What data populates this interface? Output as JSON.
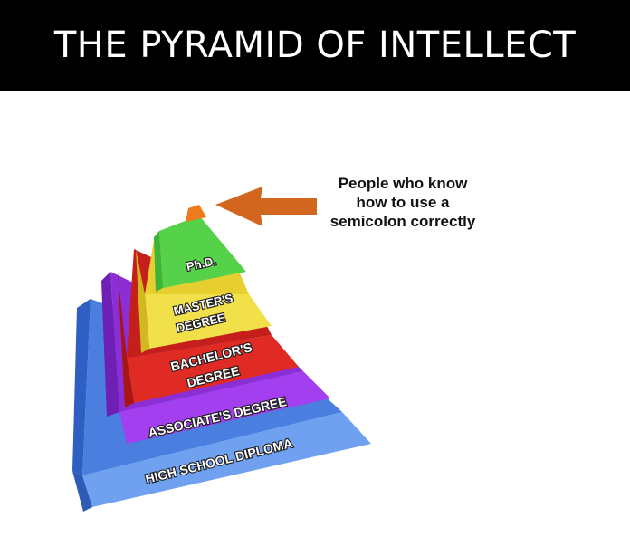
{
  "title": "THE PYRAMID OF INTELLECT",
  "callout": {
    "lines": [
      "People who know",
      "how to use a",
      "semicolon correctly"
    ]
  },
  "pyramid": {
    "layers": [
      {
        "label_lines": [
          "HIGH SCHOOL DIPLOMA"
        ],
        "color": "#4a7fe0"
      },
      {
        "label_lines": [
          "ASSOCIATE'S DEGREE"
        ],
        "color": "#9b2fe6"
      },
      {
        "label_lines": [
          "BACHELOR'S",
          "DEGREE"
        ],
        "color": "#e02b25"
      },
      {
        "label_lines": [
          "MASTER'S",
          "DEGREE"
        ],
        "color": "#f2e04a"
      },
      {
        "label_lines": [
          "Ph.D."
        ],
        "color": "#55d14a"
      }
    ],
    "apex_color": "#ee7a1e",
    "arrow_color": "#d2661f"
  }
}
